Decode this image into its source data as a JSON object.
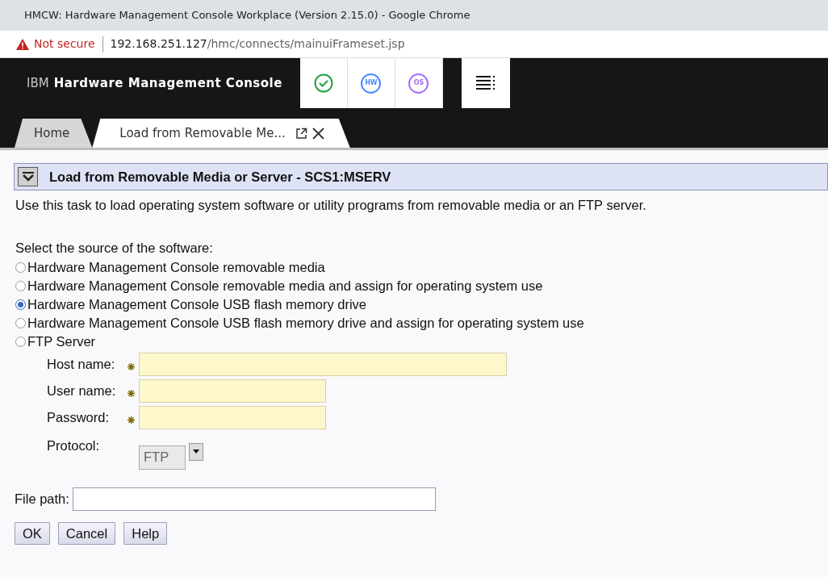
{
  "window": {
    "title": "HMCW: Hardware Management Console Workplace (Version 2.15.0) - Google Chrome"
  },
  "address_bar": {
    "warning": "Not secure",
    "url_host": "192.168.251.127",
    "url_path": "/hmc/connects/mainuiFrameset.jsp"
  },
  "app_header": {
    "brand_prefix": "IBM",
    "brand_name": "Hardware Management Console",
    "status_icons": [
      {
        "kind": "check",
        "color": "#24a148"
      },
      {
        "kind": "text",
        "label": "HW",
        "color": "#4589ff"
      },
      {
        "kind": "text",
        "label": "OS",
        "color": "#a56eff"
      }
    ]
  },
  "tabs": [
    {
      "label": "Home",
      "selected": false
    },
    {
      "label": "Load from Removable Me...",
      "selected": true
    }
  ],
  "task": {
    "title": "Load from Removable Media or Server - SCS1:MSERV",
    "description": "Use this task to load operating system software or utility programs from removable media or an FTP server.",
    "source_prompt": "Select the source of the software:",
    "sources": [
      {
        "label": "Hardware Management Console removable media",
        "selected": false
      },
      {
        "label": "Hardware Management Console removable media and assign for operating system use",
        "selected": false
      },
      {
        "label": "Hardware Management Console USB flash memory drive",
        "selected": true
      },
      {
        "label": "Hardware Management Console USB flash memory drive and assign for operating system use",
        "selected": false
      },
      {
        "label": "FTP Server",
        "selected": false
      }
    ],
    "ftp_fields": [
      {
        "label": "Host name:",
        "required": true,
        "kind": "wide"
      },
      {
        "label": "User name:",
        "required": true,
        "kind": "narrow"
      },
      {
        "label": "Password:",
        "required": true,
        "kind": "narrow"
      }
    ],
    "protocol": {
      "label": "Protocol:",
      "value": "FTP"
    },
    "file_path": {
      "label": "File path:"
    },
    "buttons": [
      "OK",
      "Cancel",
      "Help"
    ]
  }
}
